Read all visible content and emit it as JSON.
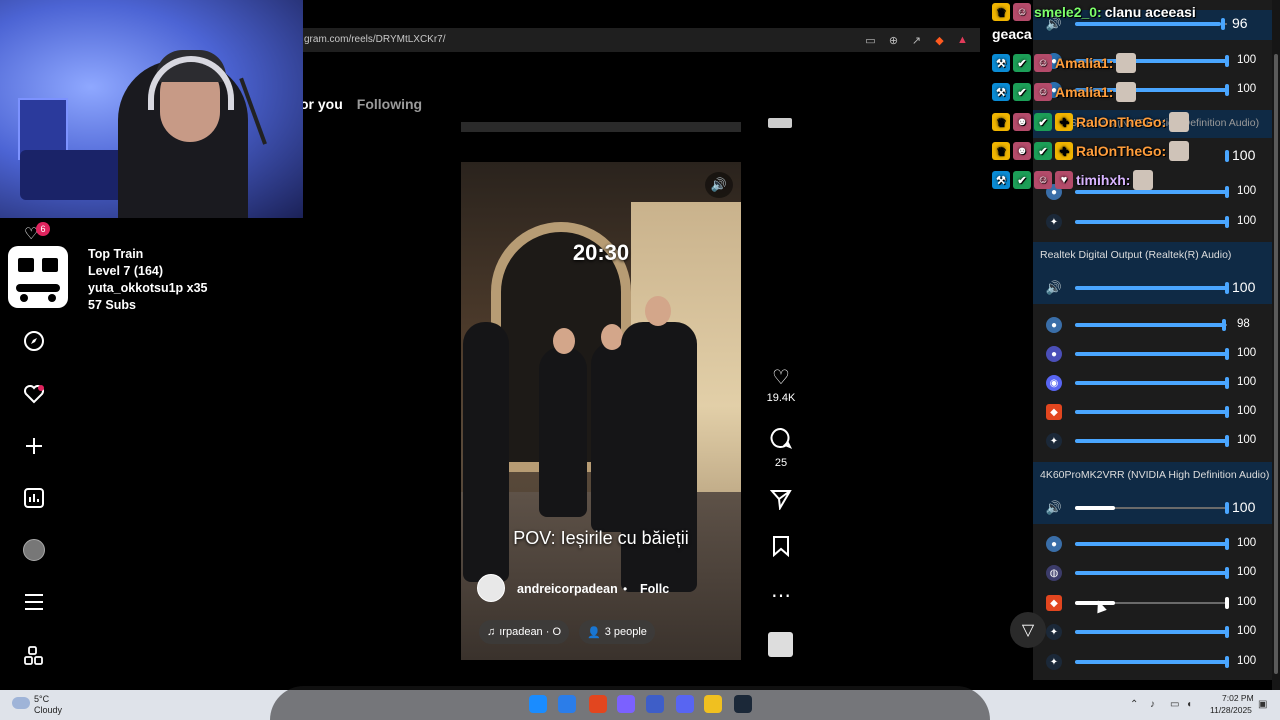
{
  "browser": {
    "url": "gram.com/reels/DRYMtLXCKr7/"
  },
  "feed_tabs": {
    "for_you": "or you",
    "following": "Following"
  },
  "sidebar": {
    "notification_count": "6",
    "items": [
      {
        "icon": "explore-icon"
      },
      {
        "icon": "heart-icon"
      },
      {
        "icon": "plus-icon"
      },
      {
        "icon": "insights-icon"
      },
      {
        "icon": "profile-avatar"
      },
      {
        "icon": "menu-icon"
      },
      {
        "icon": "apps-icon"
      }
    ]
  },
  "train_widget": {
    "title": "Top Train",
    "level": "Level 7  (164)",
    "top_user": "yuta_okkotsu1p x35",
    "subs": "57 Subs"
  },
  "video": {
    "time_overlay": "20:30",
    "caption": "POV: Ieșirile cu băieții",
    "author": "andreicorpadean",
    "separator": "•",
    "follow": "Follc",
    "audio": "ırpadean · O",
    "people": "3 people"
  },
  "actions": {
    "likes": "19.4K",
    "comments": "25"
  },
  "chat": [
    {
      "user": "smele2_0:",
      "message": "clanu aceeasi",
      "color": "#7dff6a"
    },
    {
      "user": "",
      "message": "geaca",
      "color": "#ffffff"
    },
    {
      "user": "Amalia1:",
      "message": "",
      "color": "#ff9d3b"
    },
    {
      "user": "Amalia1:",
      "message": "",
      "color": "#ff9d3b"
    },
    {
      "user": "RalOnTheGo:",
      "message": "",
      "color": "#ff9d3b"
    },
    {
      "user": "RalOnTheGo:",
      "message": "",
      "color": "#ff9d3b"
    },
    {
      "user": "timihxh:",
      "message": "",
      "color": "#d8b4ff"
    }
  ],
  "mixer": {
    "top_master_value": "96",
    "section1_header": "Speakers (NVIDIA High Definition Audio)",
    "section1_values": [
      "100",
      "100",
      "100",
      "100",
      "100"
    ],
    "section2_header": "Realtek Digital Output (Realtek(R) Audio)",
    "section2_master": "100",
    "section2_values": [
      "98",
      "100",
      "100",
      "100",
      "100"
    ],
    "section3_header": "4K60ProMK2VRR (NVIDIA High Definition Audio)",
    "section3_master": "100",
    "section3_values": [
      "100",
      "100",
      "100",
      "100",
      "100"
    ],
    "section2_levels": [
      0.98,
      1,
      1,
      1,
      1
    ],
    "section3_master_level": 0.27,
    "section3_brave_level": 0.27
  },
  "taskbar": {
    "temperature": "5°C",
    "weather": "Cloudy",
    "time": "7:02 PM",
    "date": "11/28/2025"
  },
  "colors": {
    "accent": "#4aa6ff",
    "mixer_bg": "#1c1c1c",
    "mixer_section": "#0f2a45",
    "notification": "#e0245e"
  }
}
